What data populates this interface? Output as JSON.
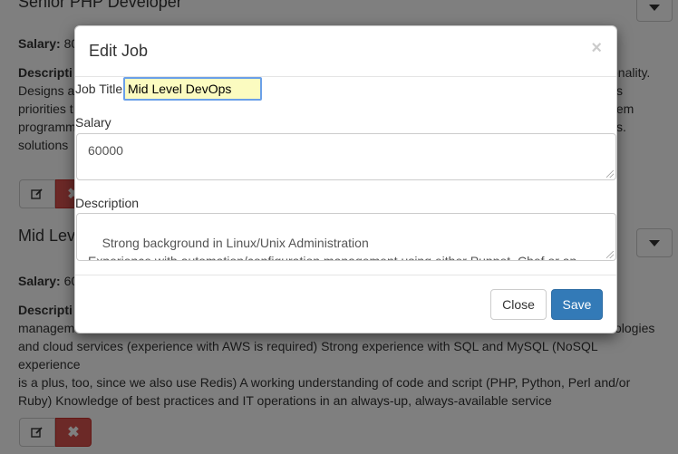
{
  "background": {
    "job1": {
      "title": "Senior PHP Developer",
      "salary_label": "Salary:",
      "salary_value": "80",
      "desc_lines": [
        "Descripti",
        "Designs a",
        "priorities t",
        "programm",
        "solutions"
      ],
      "desc_right": [
        "ctionality.",
        "s",
        "",
        "tem",
        "s."
      ]
    },
    "job2": {
      "title": "Mid Lev",
      "salary_label": "Salary:",
      "salary_value": "60",
      "desc_label": "Descripti",
      "desc_text_line1": "managem",
      "desc_text_line1_right": "ologies",
      "desc_text_rest": [
        "and cloud services (experience with AWS is required) Strong experience with SQL and MySQL (NoSQL experience",
        "is a plus, too, since we also use Redis) A working understanding of code and script (PHP, Python, Perl and/or",
        "Ruby) Knowledge of best practices and IT operations in an always-up, always-available service"
      ]
    },
    "delete_glyph": "✖",
    "edit_icon": "edit-icon"
  },
  "modal": {
    "title": "Edit Job",
    "close_glyph": "×",
    "job_title_label": "Job Title",
    "job_title_value": "Mid Level DevOps",
    "salary_label": "Salary",
    "salary_value": "60000",
    "description_label": "Description",
    "description_value": "Strong background in Linux/Unix Administration\nExperience with automation/configuration management using either Puppet, Chef or an equivalent",
    "close_button": "Close",
    "save_button": "Save"
  },
  "colors": {
    "save": "#337ab7",
    "delete": "#d9534f",
    "focused_input_bg": "#fbfbc0"
  }
}
